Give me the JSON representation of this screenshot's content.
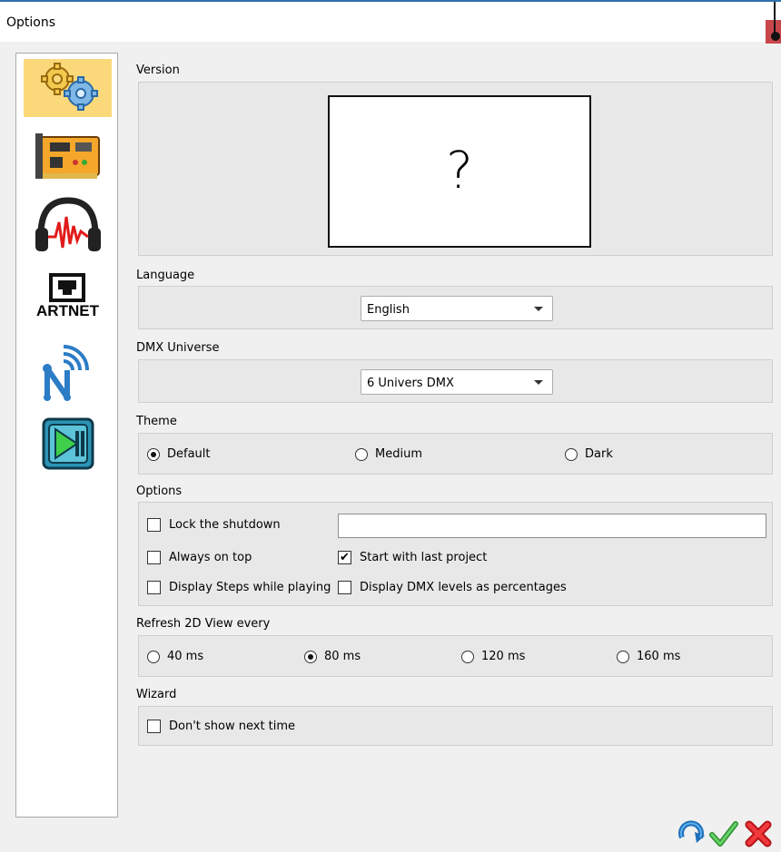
{
  "window": {
    "title": "Options"
  },
  "sidebar": {
    "items": [
      {
        "name": "general-settings",
        "icon": "gears-icon"
      },
      {
        "name": "dmx-interface",
        "icon": "circuit-board-icon"
      },
      {
        "name": "audio",
        "icon": "headphones-icon"
      },
      {
        "name": "artnet",
        "icon": "network-port-icon",
        "label": "ARTNET"
      },
      {
        "name": "wireless",
        "icon": "wireless-n-icon"
      },
      {
        "name": "player",
        "icon": "play-controls-icon"
      }
    ]
  },
  "version": {
    "label": "Version",
    "placeholder_glyph": "?"
  },
  "language": {
    "label": "Language",
    "selected": "English"
  },
  "dmx_universe": {
    "label": "DMX Universe",
    "selected": "6 Univers DMX"
  },
  "theme": {
    "label": "Theme",
    "options": [
      {
        "label": "Default",
        "checked": true
      },
      {
        "label": "Medium",
        "checked": false
      },
      {
        "label": "Dark",
        "checked": false
      }
    ]
  },
  "options": {
    "label": "Options",
    "lock_shutdown": {
      "label": "Lock the shutdown",
      "checked": false,
      "value": ""
    },
    "always_on_top": {
      "label": "Always on top",
      "checked": false
    },
    "start_last_project": {
      "label": "Start with last project",
      "checked": true
    },
    "display_steps": {
      "label": "Display Steps while playing",
      "checked": false
    },
    "display_percent": {
      "label": "Display DMX levels as percentages",
      "checked": false
    }
  },
  "refresh": {
    "label": "Refresh 2D View every",
    "options": [
      {
        "label": "40 ms",
        "checked": false
      },
      {
        "label": "80 ms",
        "checked": true
      },
      {
        "label": "120 ms",
        "checked": false
      },
      {
        "label": "160 ms",
        "checked": false
      }
    ]
  },
  "wizard": {
    "label": "Wizard",
    "dont_show": {
      "label": "Don't show next time",
      "checked": false
    }
  },
  "footer": {
    "buttons": [
      "reset-icon",
      "ok-check-icon",
      "cancel-x-icon"
    ]
  },
  "colors": {
    "accent": "#2f6fad",
    "close": "#c8474b",
    "active_item": "#fbd97a",
    "ok": "#3aa83a",
    "cancel": "#e0262b"
  }
}
